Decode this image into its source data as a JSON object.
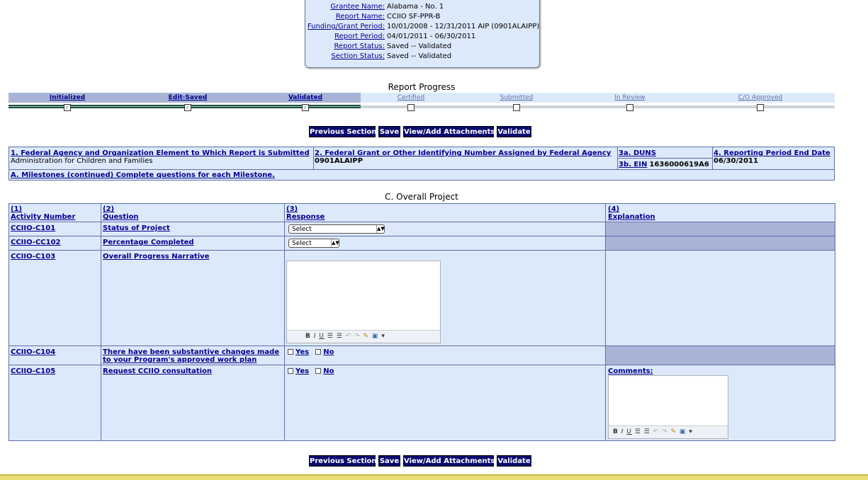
{
  "header": {
    "rows": [
      {
        "label": "Grantee Name:",
        "value": "Alabama - No. 1"
      },
      {
        "label": "Report Name:",
        "value": "CCIIO SF-PPR-B"
      },
      {
        "label": "Funding/Grant Period:",
        "value": "10/01/2008 - 12/31/2011 AIP (0901ALAIPP)"
      },
      {
        "label": "Report Period:",
        "value": "04/01/2011 - 06/30/2011"
      },
      {
        "label": "Report Status:",
        "value": "Saved -- Validated"
      },
      {
        "label": "Section Status:",
        "value": "Saved -- Validated"
      }
    ]
  },
  "progress": {
    "title": "Report Progress",
    "steps": [
      {
        "label": "Initialized",
        "done": true
      },
      {
        "label": "Edit-Saved",
        "done": true
      },
      {
        "label": "Validated",
        "done": true
      },
      {
        "label": "Certified",
        "done": false
      },
      {
        "label": "Submitted",
        "done": false
      },
      {
        "label": "In Review",
        "done": false
      },
      {
        "label": "C/O Approved",
        "done": false
      }
    ]
  },
  "buttons": {
    "previous": "Previous Section",
    "save": "Save",
    "attachments": "View/Add Attachments",
    "validate": "Validate"
  },
  "info": {
    "agency_label": "1. Federal Agency and Organization Element to Which Report is Submitted",
    "agency_value": "Administration for Children and Families",
    "grant_label": "2. Federal Grant or Other Identifying Number Assigned by Federal Agency",
    "grant_value": "0901ALAIPP",
    "duns_label": "3a. DUNS",
    "ein_label": "3b. EIN",
    "ein_value": "1636000619A6",
    "period_end_label": "4. Reporting Period End Date",
    "period_end_value": "06/30/2011",
    "milestones_label": "A. Milestones (continued) Complete questions for each Milestone."
  },
  "section_c": {
    "title": "C. Overall Project",
    "columns": [
      {
        "num": "(1)",
        "name": "Activity Number"
      },
      {
        "num": "(2)",
        "name": "Question"
      },
      {
        "num": "(3)",
        "name": "Response"
      },
      {
        "num": "(4)",
        "name": "Explanation"
      }
    ],
    "rows": [
      {
        "activity": "CCIIO-C101",
        "question": "Status of Project"
      },
      {
        "activity": "CCIIO-CC102",
        "question": "Percentage Completed"
      },
      {
        "activity": "CCIIO-C103",
        "question": "Overall Progress Narrative"
      },
      {
        "activity": "CCIIO-C104",
        "question": "There have been substantive changes made to your Program's approved work plan"
      },
      {
        "activity": "CCIIO-C105",
        "question": "Request CCIIO consultation"
      }
    ],
    "select_placeholder": "Select",
    "yes_label": "Yes",
    "no_label": "No",
    "comments_label": "Comments:"
  }
}
